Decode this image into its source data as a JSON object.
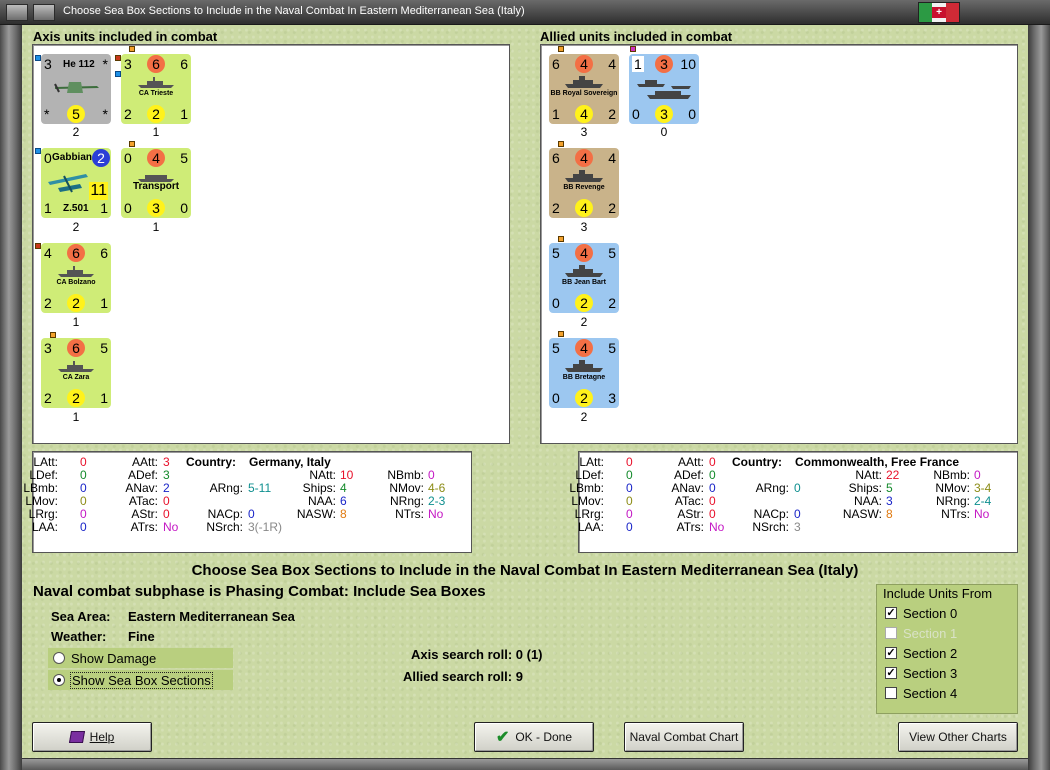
{
  "window": {
    "title": "Choose Sea Box Sections to Include in the Naval Combat In Eastern Mediterranean Sea (Italy)"
  },
  "axis": {
    "header": "Axis units included in combat",
    "units": [
      {
        "name": "He 112",
        "tl": "3",
        "tr": "*",
        "bl": "*",
        "br": "*",
        "circle": "5",
        "count": "2"
      },
      {
        "name": "CA Trieste",
        "tl": "3",
        "top": "6",
        "tr": "6",
        "bl": "2",
        "bot": "2",
        "br": "1",
        "count": "1"
      },
      {
        "name": "Gabbiano",
        "name2": "Z.501",
        "tl": "0",
        "circle": "2",
        "big": "11",
        "bl": "1",
        "br": "1",
        "count": "2"
      },
      {
        "name": "Transport",
        "tl": "0",
        "top": "4",
        "tr": "5",
        "bl": "0",
        "bot": "3",
        "br": "0",
        "count": "1"
      },
      {
        "name": "CA Bolzano",
        "tl": "4",
        "top": "6",
        "tr": "6",
        "bl": "2",
        "bot": "2",
        "br": "1",
        "count": "1"
      },
      {
        "name": "CA Zara",
        "tl": "3",
        "top": "6",
        "tr": "5",
        "bl": "2",
        "bot": "2",
        "br": "1",
        "count": "1"
      }
    ]
  },
  "allied": {
    "header": "Allied units included in combat",
    "units": [
      {
        "name": "BB Royal Sovereign",
        "tl": "6",
        "top": "4",
        "tr": "4",
        "bl": "1",
        "bot": "4",
        "br": "2",
        "count": "3"
      },
      {
        "name": "",
        "tl": "1",
        "top": "3",
        "tr": "10",
        "bl": "0",
        "bot": "3",
        "br": "0",
        "count": "0"
      },
      {
        "name": "BB Revenge",
        "tl": "6",
        "top": "4",
        "tr": "4",
        "bl": "2",
        "bot": "4",
        "br": "2",
        "count": "3"
      },
      {
        "name": "BB Jean Bart",
        "tl": "5",
        "top": "4",
        "tr": "5",
        "bl": "0",
        "bot": "2",
        "br": "2",
        "count": "2"
      },
      {
        "name": "BB Bretagne",
        "tl": "5",
        "top": "4",
        "tr": "5",
        "bl": "0",
        "bot": "2",
        "br": "3",
        "count": "2"
      }
    ]
  },
  "axis_stats": {
    "LAtt": "0",
    "LDef": "0",
    "LBmb": "0",
    "LMov": "0",
    "LRrg": "0",
    "LAA": "0",
    "AAtt": "3",
    "ADef": "3",
    "ANav": "2",
    "ATac": "0",
    "AStr": "0",
    "ATrs": "No",
    "country_label": "Country:",
    "country": "Germany, Italy",
    "ARng": "5-11",
    "NACp": "0",
    "NSrch": "3(-1R)",
    "NAtt": "10",
    "Ships": "4",
    "NAA": "6",
    "NASW": "8",
    "NBmb": "0",
    "NMov": "4-6",
    "NRng": "2-3",
    "NTrs": "No"
  },
  "allied_stats": {
    "LAtt": "0",
    "LDef": "0",
    "LBmb": "0",
    "LMov": "0",
    "LRrg": "0",
    "LAA": "0",
    "AAtt": "0",
    "ADef": "0",
    "ANav": "0",
    "ATac": "0",
    "AStr": "0",
    "ATrs": "No",
    "country_label": "Country:",
    "country": "Commonwealth, Free France",
    "ARng": "0",
    "NACp": "0",
    "NSrch": "3",
    "NAtt": "22",
    "Ships": "5",
    "NAA": "3",
    "NASW": "8",
    "NBmb": "0",
    "NMov": "3-4",
    "NRng": "2-4",
    "NTrs": "No"
  },
  "main": {
    "title": "Choose Sea Box Sections to Include in the Naval Combat In Eastern Mediterranean Sea (Italy)",
    "subphase": "Naval combat subphase is Phasing Combat: Include Sea Boxes",
    "sea_area_label": "Sea Area:",
    "sea_area": "Eastern Mediterranean Sea",
    "weather_label": "Weather:",
    "weather": "Fine",
    "show_damage": "Show Damage",
    "show_sections": "Show Sea Box Sections",
    "axis_search": "Axis search roll: 0 (1)",
    "allied_search": "Allied search roll: 9"
  },
  "include": {
    "title": "Include Units From",
    "sections": [
      {
        "label": "Section 0",
        "checked": true,
        "enabled": true
      },
      {
        "label": "Section 1",
        "checked": false,
        "enabled": false
      },
      {
        "label": "Section 2",
        "checked": true,
        "enabled": true
      },
      {
        "label": "Section 3",
        "checked": true,
        "enabled": true
      },
      {
        "label": "Section 4",
        "checked": false,
        "enabled": true
      }
    ]
  },
  "buttons": {
    "help": "Help",
    "ok": "OK - Done",
    "chart": "Naval Combat Chart",
    "other": "View Other Charts"
  },
  "colors": {
    "axis_counter": "#cfec77",
    "allied_counter": "#9cc7f0",
    "brit_counter": "#c9b38a",
    "plane_counter": "#b3b3b3"
  }
}
